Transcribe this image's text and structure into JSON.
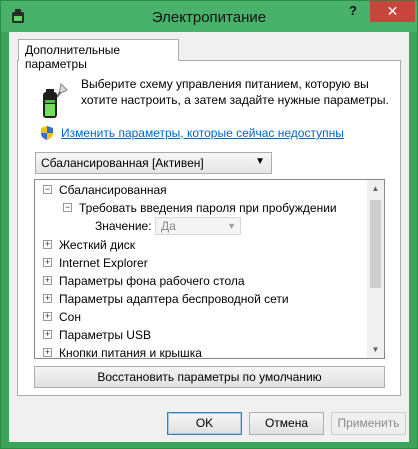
{
  "window": {
    "title": "Электропитание",
    "help_label": "?",
    "close_label": "✕"
  },
  "tab": {
    "label": "Дополнительные параметры"
  },
  "description": "Выберите схему управления питанием, которую вы хотите настроить, а затем задайте нужные параметры.",
  "change_link": "Изменить параметры, которые сейчас недоступны",
  "scheme": {
    "selected": "Сбалансированная [Активен]"
  },
  "tree": {
    "items": [
      {
        "label": "Сбалансированная",
        "toggle": "−",
        "level": 0
      },
      {
        "label": "Требовать введения пароля при пробуждении",
        "toggle": "−",
        "level": 1
      },
      {
        "label": "Жесткий диск",
        "toggle": "+",
        "level": 0
      },
      {
        "label": "Internet Explorer",
        "toggle": "+",
        "level": 0
      },
      {
        "label": "Параметры фона рабочего стола",
        "toggle": "+",
        "level": 0
      },
      {
        "label": "Параметры адаптера беспроводной сети",
        "toggle": "+",
        "level": 0
      },
      {
        "label": "Сон",
        "toggle": "+",
        "level": 0
      },
      {
        "label": "Параметры USB",
        "toggle": "+",
        "level": 0
      },
      {
        "label": "Кнопки питания и крышка",
        "toggle": "+",
        "level": 0
      }
    ],
    "value_row": {
      "label": "Значение:",
      "value": "Да"
    }
  },
  "restore_button": "Восстановить параметры по умолчанию",
  "buttons": {
    "ok": "OK",
    "cancel": "Отмена",
    "apply": "Применить"
  },
  "colors": {
    "accent": "#48b26a",
    "close": "#c7453a",
    "link": "#0066cc"
  }
}
